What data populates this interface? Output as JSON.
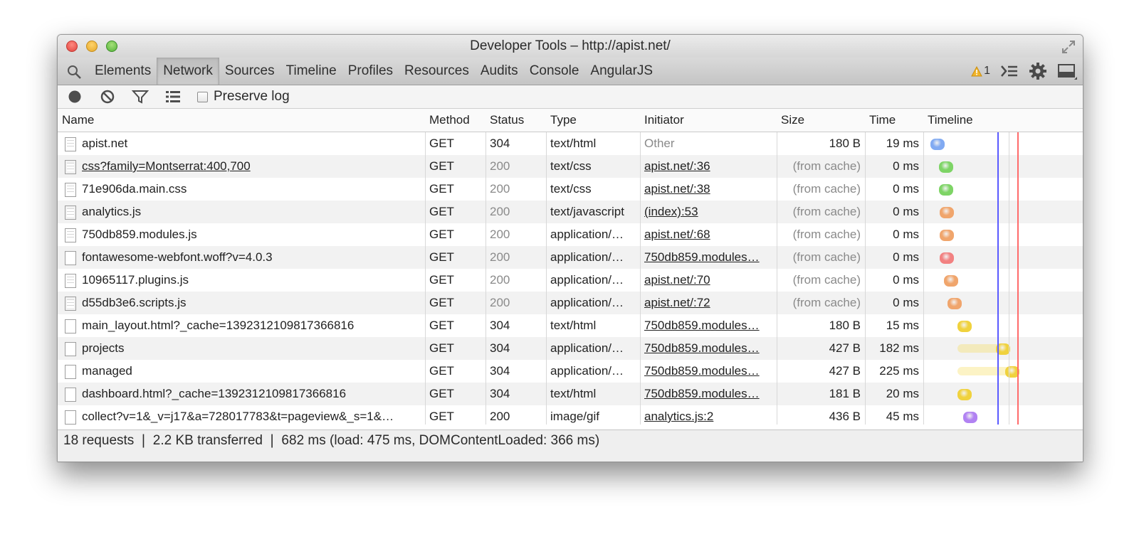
{
  "window": {
    "title": "Developer Tools – http://apist.net/"
  },
  "tabs": [
    {
      "label": "Elements",
      "active": false
    },
    {
      "label": "Network",
      "active": true
    },
    {
      "label": "Sources",
      "active": false
    },
    {
      "label": "Timeline",
      "active": false
    },
    {
      "label": "Profiles",
      "active": false
    },
    {
      "label": "Resources",
      "active": false
    },
    {
      "label": "Audits",
      "active": false
    },
    {
      "label": "Console",
      "active": false
    },
    {
      "label": "AngularJS",
      "active": false
    }
  ],
  "warnings": {
    "count": "1"
  },
  "toolbar": {
    "preserve_log": "Preserve log",
    "preserve_checked": false
  },
  "columns": {
    "name": "Name",
    "method": "Method",
    "status": "Status",
    "type": "Type",
    "initiator": "Initiator",
    "size": "Size",
    "time": "Time",
    "timeline": "Timeline"
  },
  "colors": {
    "dom_content_loaded": "#5a5aff",
    "load": "#ff6b6b",
    "html": "#8fb3ff",
    "css": "#8fdb7a",
    "script": "#f2b07e",
    "font": "#f08c8c",
    "xhr": "#f7dc5a",
    "image": "#b58cf0"
  },
  "requests": [
    {
      "name": "apist.net",
      "method": "GET",
      "status": "304",
      "type": "text/html",
      "initiator": "Other",
      "size": "180 B",
      "time": "19 ms",
      "kind": "html",
      "icon": "doc",
      "underline": false,
      "init_link": false,
      "dim": false,
      "start": 0.0,
      "wait": 0.0,
      "recv": 0.028
    },
    {
      "name": "css?family=Montserrat:400,700",
      "method": "GET",
      "status": "200",
      "type": "text/css",
      "initiator": "apist.net/:36",
      "size": "(from cache)",
      "time": "0 ms",
      "kind": "css",
      "icon": "doc",
      "underline": true,
      "init_link": true,
      "dim": true,
      "start": 0.045,
      "wait": 0.0,
      "recv": 0.0
    },
    {
      "name": "71e906da.main.css",
      "method": "GET",
      "status": "200",
      "type": "text/css",
      "initiator": "apist.net/:38",
      "size": "(from cache)",
      "time": "0 ms",
      "kind": "css",
      "icon": "doc",
      "underline": false,
      "init_link": true,
      "dim": true,
      "start": 0.045,
      "wait": 0.0,
      "recv": 0.0
    },
    {
      "name": "analytics.js",
      "method": "GET",
      "status": "200",
      "type": "text/javascript",
      "initiator": "(index):53",
      "size": "(from cache)",
      "time": "0 ms",
      "kind": "script",
      "icon": "doc",
      "underline": false,
      "init_link": true,
      "dim": true,
      "start": 0.05,
      "wait": 0.0,
      "recv": 0.0
    },
    {
      "name": "750db859.modules.js",
      "method": "GET",
      "status": "200",
      "type": "application/…",
      "initiator": "apist.net/:68",
      "size": "(from cache)",
      "time": "0 ms",
      "kind": "script",
      "icon": "doc",
      "underline": false,
      "init_link": true,
      "dim": true,
      "start": 0.05,
      "wait": 0.0,
      "recv": 0.0
    },
    {
      "name": "fontawesome-webfont.woff?v=4.0.3",
      "method": "GET",
      "status": "200",
      "type": "application/…",
      "initiator": "750db859.modules…",
      "size": "(from cache)",
      "time": "0 ms",
      "kind": "font",
      "icon": "blank",
      "underline": false,
      "init_link": true,
      "dim": true,
      "start": 0.052,
      "wait": 0.0,
      "recv": 0.0
    },
    {
      "name": "10965117.plugins.js",
      "method": "GET",
      "status": "200",
      "type": "application/…",
      "initiator": "apist.net/:70",
      "size": "(from cache)",
      "time": "0 ms",
      "kind": "script",
      "icon": "doc",
      "underline": false,
      "init_link": true,
      "dim": true,
      "start": 0.075,
      "wait": 0.0,
      "recv": 0.0
    },
    {
      "name": "d55db3e6.scripts.js",
      "method": "GET",
      "status": "200",
      "type": "application/…",
      "initiator": "apist.net/:72",
      "size": "(from cache)",
      "time": "0 ms",
      "kind": "script",
      "icon": "doc",
      "underline": false,
      "init_link": true,
      "dim": true,
      "start": 0.095,
      "wait": 0.0,
      "recv": 0.0
    },
    {
      "name": "main_layout.html?_cache=1392312109817366816",
      "method": "GET",
      "status": "304",
      "type": "text/html",
      "initiator": "750db859.modules…",
      "size": "180 B",
      "time": "15 ms",
      "kind": "xhr",
      "icon": "blank",
      "underline": false,
      "init_link": true,
      "dim": false,
      "start": 0.148,
      "wait": 0.0,
      "recv": 0.022
    },
    {
      "name": "projects",
      "method": "GET",
      "status": "304",
      "type": "application/…",
      "initiator": "750db859.modules…",
      "size": "427 B",
      "time": "182 ms",
      "kind": "xhr",
      "icon": "blank",
      "underline": false,
      "init_link": true,
      "dim": false,
      "start": 0.148,
      "wait": 0.21,
      "recv": 0.03
    },
    {
      "name": "managed",
      "method": "GET",
      "status": "304",
      "type": "application/…",
      "initiator": "750db859.modules…",
      "size": "427 B",
      "time": "225 ms",
      "kind": "xhr",
      "icon": "blank",
      "underline": false,
      "init_link": true,
      "dim": false,
      "start": 0.148,
      "wait": 0.26,
      "recv": 0.03
    },
    {
      "name": "dashboard.html?_cache=1392312109817366816",
      "method": "GET",
      "status": "304",
      "type": "text/html",
      "initiator": "750db859.modules…",
      "size": "181 B",
      "time": "20 ms",
      "kind": "xhr",
      "icon": "blank",
      "underline": false,
      "init_link": true,
      "dim": false,
      "start": 0.15,
      "wait": 0.0,
      "recv": 0.03
    },
    {
      "name": "collect?v=1&_v=j17&a=728017783&t=pageview&_s=1&…",
      "method": "GET",
      "status": "200",
      "type": "image/gif",
      "initiator": "analytics.js:2",
      "size": "436 B",
      "time": "45 ms",
      "kind": "image",
      "icon": "blank",
      "underline": false,
      "init_link": true,
      "dim": false,
      "start": 0.18,
      "wait": 0.0,
      "recv": 0.05
    }
  ],
  "timeline": {
    "dom_content_loaded": 0.366,
    "load": 0.475,
    "total": 0.682
  },
  "summary": "18 requests ❘ 2.2 KB transferred ❘ 682 ms (load: 475 ms, DOMContentLoaded: 366 ms)"
}
